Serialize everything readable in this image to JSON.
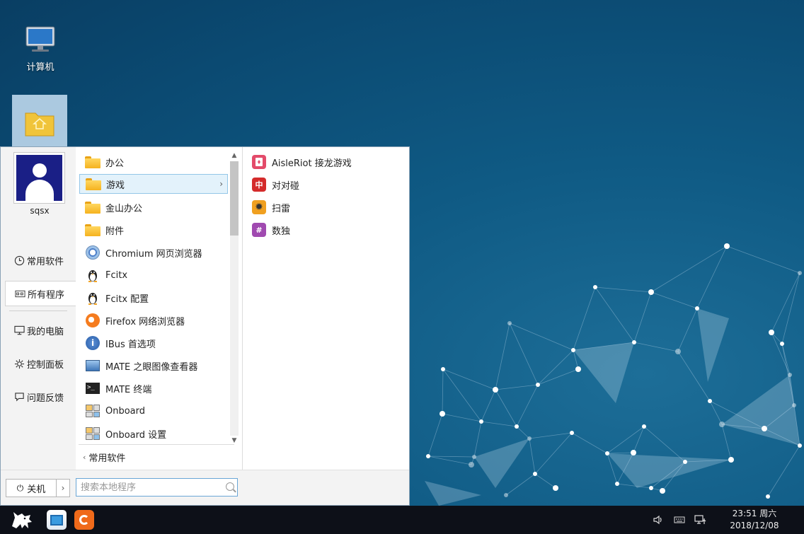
{
  "desktop": {
    "icons": [
      {
        "label": "计算机",
        "icon": "computer-icon"
      },
      {
        "label": "",
        "icon": "home-folder-icon"
      }
    ]
  },
  "start_menu": {
    "user": {
      "name": "sqsx"
    },
    "nav": [
      {
        "label": "常用软件",
        "icon": "clock-icon"
      },
      {
        "label": "所有程序",
        "icon": "grid-icon",
        "active": true
      },
      {
        "label": "我的电脑",
        "icon": "monitor-icon"
      },
      {
        "label": "控制面板",
        "icon": "gear-icon"
      },
      {
        "label": "问题反馈",
        "icon": "chat-icon"
      }
    ],
    "apps": [
      {
        "label": "办公",
        "icon": "folder-icon"
      },
      {
        "label": "游戏",
        "icon": "folder-icon",
        "selected": true,
        "arrow": "›"
      },
      {
        "label": "金山办公",
        "icon": "folder-icon"
      },
      {
        "label": "附件",
        "icon": "folder-icon"
      },
      {
        "label": "Chromium 网页浏览器",
        "icon": "chromium-icon"
      },
      {
        "label": "Fcitx",
        "icon": "penguin-icon"
      },
      {
        "label": "Fcitx 配置",
        "icon": "penguin-icon"
      },
      {
        "label": "Firefox 网络浏览器",
        "icon": "firefox-icon"
      },
      {
        "label": "IBus 首选项",
        "icon": "ibus-icon",
        "glyph": "i"
      },
      {
        "label": "MATE 之眼图像查看器",
        "icon": "image-viewer-icon"
      },
      {
        "label": "MATE 终端",
        "icon": "terminal-icon",
        "glyph": ">_"
      },
      {
        "label": "Onboard",
        "icon": "keyboard-icon"
      },
      {
        "label": "Onboard 设置",
        "icon": "keyboard-settings-icon"
      }
    ],
    "games": [
      {
        "label": "AisleRiot 接龙游戏",
        "icon": "cards-icon",
        "color": "#e34b6a"
      },
      {
        "label": "对对碰",
        "icon": "mahjong-icon",
        "color": "#d42b2b",
        "glyph": "中"
      },
      {
        "label": "扫雷",
        "icon": "mine-icon",
        "color": "#f0a020",
        "glyph": "✹"
      },
      {
        "label": "数独",
        "icon": "sudoku-icon",
        "color": "#a04ab0",
        "glyph": "#"
      }
    ],
    "back_label": "常用软件",
    "back_chevron": "‹",
    "shutdown_label": "关机",
    "search_placeholder": "搜索本地程序"
  },
  "taskbar": {
    "clock_time": "23:51 周六",
    "clock_date": "2018/12/08"
  },
  "colors": {
    "accent": "#6aa6d6",
    "selected_bg": "#e3f2fb",
    "taskbar": "#0d1018",
    "desktop_bg": "#0f5a84"
  }
}
